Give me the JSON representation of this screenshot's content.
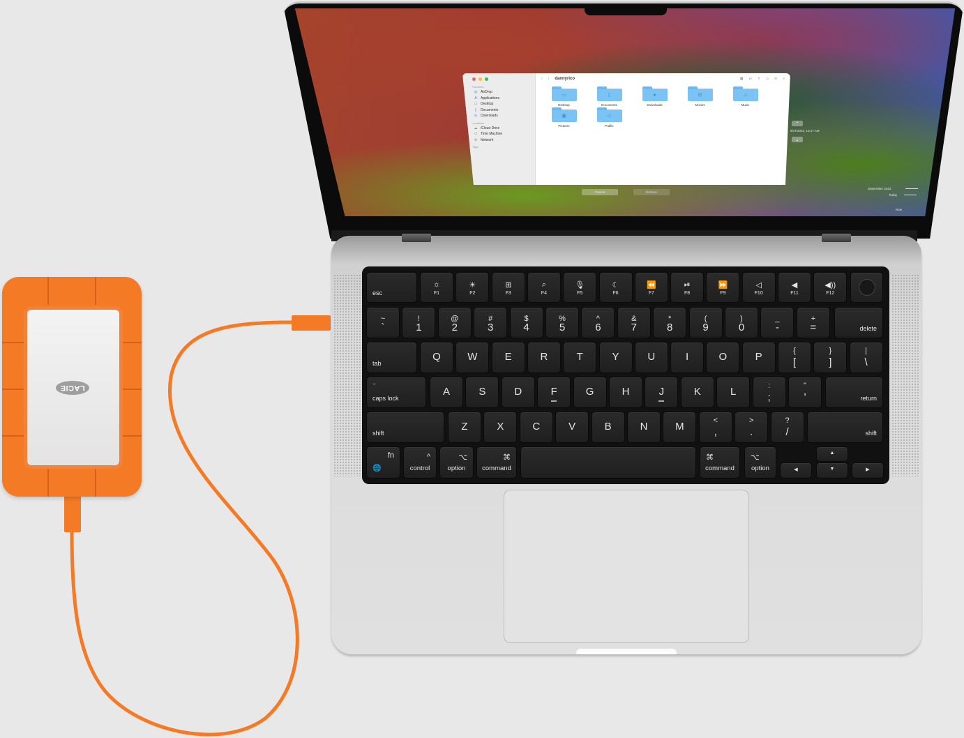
{
  "scene": "LaCie Rugged drive connected to MacBook Pro running Time Machine restore",
  "colors": {
    "drive_orange": "#f47a26",
    "folder_blue": "#7cc3f5",
    "keyboard": "#1f1f1f",
    "chassis": "#dadada"
  },
  "finder": {
    "traffic_lights": [
      "#ff5f57",
      "#febc2e",
      "#28c840"
    ],
    "title": "dannyrico",
    "back_icon": "‹",
    "forward_icon": "›",
    "toolbar_icons": [
      "view-icon",
      "group-icon",
      "share-icon",
      "tag-icon",
      "action-icon",
      "search-icon"
    ],
    "sidebar": {
      "favorites_header": "Favorites",
      "favorites": [
        {
          "label": "AirDrop",
          "icon": "airdrop-icon",
          "glyph": "◎"
        },
        {
          "label": "Applications",
          "icon": "applications-icon",
          "glyph": "A"
        },
        {
          "label": "Desktop",
          "icon": "desktop-icon",
          "glyph": "▭"
        },
        {
          "label": "Documents",
          "icon": "documents-icon",
          "glyph": "▯"
        },
        {
          "label": "Downloads",
          "icon": "downloads-icon",
          "glyph": "⊙"
        }
      ],
      "locations_header": "Locations",
      "locations": [
        {
          "label": "iCloud Drive",
          "icon": "icloud-icon",
          "glyph": "☁"
        },
        {
          "label": "Time Machine",
          "icon": "time-machine-icon",
          "glyph": "↺"
        },
        {
          "label": "Network",
          "icon": "network-icon",
          "glyph": "⊕"
        }
      ],
      "tags_header": "Tags"
    },
    "folders": [
      {
        "label": "Desktop",
        "glyph": "▭"
      },
      {
        "label": "Documents",
        "glyph": "▯"
      },
      {
        "label": "Downloads",
        "glyph": "●"
      },
      {
        "label": "Movies",
        "glyph": "⊟"
      },
      {
        "label": "Music",
        "glyph": "♫"
      },
      {
        "label": "Pictures",
        "glyph": "▣"
      },
      {
        "label": "Public",
        "glyph": "◇"
      }
    ]
  },
  "time_machine": {
    "cancel_label": "Cancel",
    "restore_label": "Restore",
    "up_arrow": "⌃",
    "down_arrow": "⌄",
    "snapshot_time": "9/27/2023, 10:17 AM",
    "timeline": [
      "September 2023",
      "Today",
      "Now"
    ]
  },
  "keyboard": {
    "function_row": [
      {
        "label": "esc"
      },
      {
        "label": "F1",
        "icon": "brightness-down-icon",
        "glyph": "☼"
      },
      {
        "label": "F2",
        "icon": "brightness-up-icon",
        "glyph": "☀"
      },
      {
        "label": "F3",
        "icon": "mission-control-icon",
        "glyph": "⊞"
      },
      {
        "label": "F4",
        "icon": "spotlight-icon",
        "glyph": "⌕"
      },
      {
        "label": "F5",
        "icon": "dictation-icon",
        "glyph": "🎙"
      },
      {
        "label": "F6",
        "icon": "do-not-disturb-icon",
        "glyph": "☾"
      },
      {
        "label": "F7",
        "icon": "rewind-icon",
        "glyph": "⏪"
      },
      {
        "label": "F8",
        "icon": "play-pause-icon",
        "glyph": "⏯"
      },
      {
        "label": "F9",
        "icon": "fast-forward-icon",
        "glyph": "⏩"
      },
      {
        "label": "F10",
        "icon": "mute-icon",
        "glyph": "◁"
      },
      {
        "label": "F11",
        "icon": "volume-down-icon",
        "glyph": "◀"
      },
      {
        "label": "F12",
        "icon": "volume-up-icon",
        "glyph": "◀))"
      }
    ],
    "number_row": [
      {
        "top": "~",
        "main": "`"
      },
      {
        "top": "!",
        "main": "1"
      },
      {
        "top": "@",
        "main": "2"
      },
      {
        "top": "#",
        "main": "3"
      },
      {
        "top": "$",
        "main": "4"
      },
      {
        "top": "%",
        "main": "5"
      },
      {
        "top": "^",
        "main": "6"
      },
      {
        "top": "&",
        "main": "7"
      },
      {
        "top": "*",
        "main": "8"
      },
      {
        "top": "(",
        "main": "9"
      },
      {
        "top": ")",
        "main": "0"
      },
      {
        "top": "_",
        "main": "-"
      },
      {
        "top": "+",
        "main": "="
      },
      {
        "label": "delete"
      }
    ],
    "qwerty_row": [
      "tab",
      "Q",
      "W",
      "E",
      "R",
      "T",
      "Y",
      "U",
      "I",
      "O",
      "P",
      {
        "top": "{",
        "main": "["
      },
      {
        "top": "}",
        "main": "]"
      },
      {
        "top": "|",
        "main": "\\"
      }
    ],
    "home_row": [
      "caps lock",
      "A",
      "S",
      "D",
      "F",
      "G",
      "H",
      "J",
      "K",
      "L",
      {
        "top": ":",
        "main": ";"
      },
      {
        "top": "\"",
        "main": "'"
      },
      "return"
    ],
    "shift_row": [
      "shift",
      "Z",
      "X",
      "C",
      "V",
      "B",
      "N",
      "M",
      {
        "top": "<",
        "main": ","
      },
      {
        "top": ">",
        "main": "."
      },
      {
        "top": "?",
        "main": "/"
      },
      "shift"
    ],
    "bottom_row": {
      "fn": "fn",
      "globe": "🌐",
      "control": "control",
      "control_sym": "^",
      "option": "option",
      "option_sym": "⌥",
      "command": "command",
      "command_sym": "⌘",
      "arrow_up": "▲",
      "arrow_down": "▼",
      "arrow_left": "◀",
      "arrow_right": "▶"
    }
  },
  "drive": {
    "brand": "LACIE"
  }
}
